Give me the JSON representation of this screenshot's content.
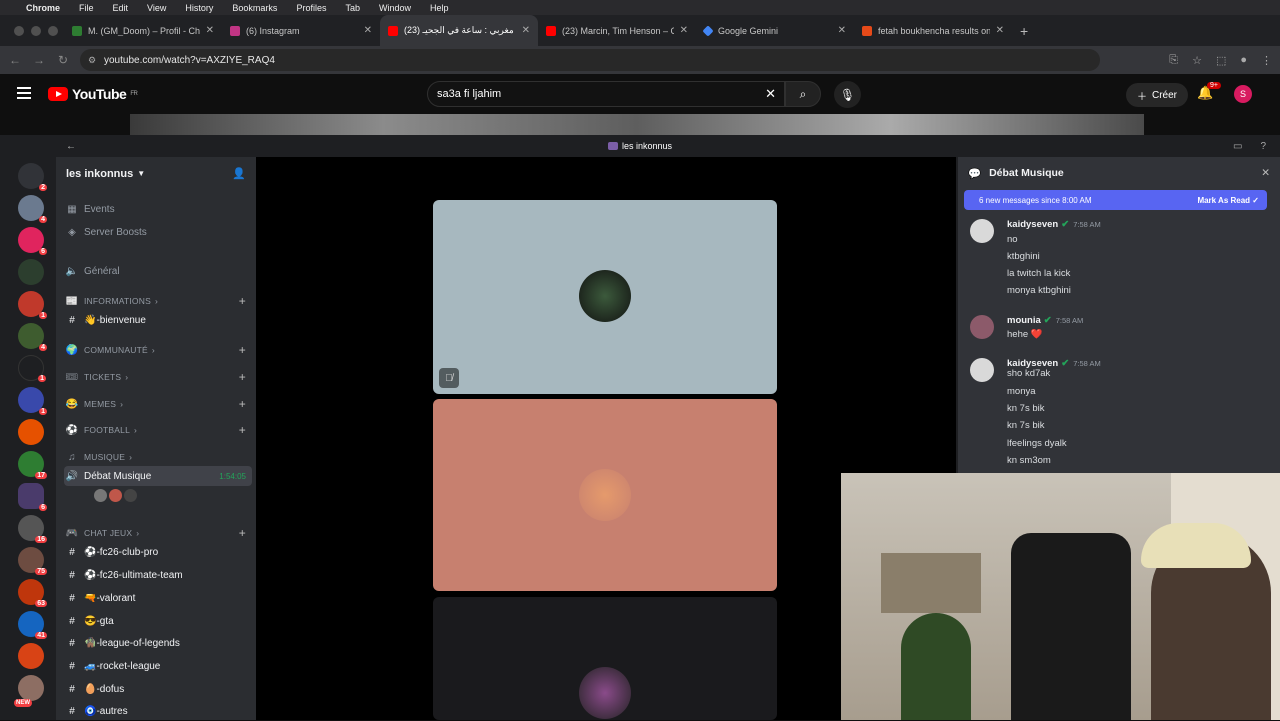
{
  "mac_menu": {
    "apple": "",
    "app": "Chrome",
    "items": [
      "File",
      "Edit",
      "View",
      "History",
      "Bookmarks",
      "Profiles",
      "Tab",
      "Window",
      "Help"
    ]
  },
  "tabs": [
    {
      "title": "M. (GM_Doom) – Profil - Che",
      "color": "#2e7d32"
    },
    {
      "title": "(6) Instagram",
      "color": "#c13584"
    },
    {
      "title": "(23) فيلم مغربي : ساعة في الجحيـ",
      "color": "#ff0000"
    },
    {
      "title": "(23) Marcin, Tim Henson – Cli",
      "color": "#ff0000"
    },
    {
      "title": "Google Gemini",
      "color": "#4285f4"
    },
    {
      "title": "fetah boukhencha results on",
      "color": "#e64a19"
    }
  ],
  "address": {
    "url": "youtube.com/watch?v=AXZIYE_RAQ4"
  },
  "youtube": {
    "logo_text": "YouTube",
    "region": "FR",
    "search_value": "sa3a fi ljahim",
    "create_label": "Créer",
    "notif_count": "9+",
    "avatar_letter": "S"
  },
  "discord": {
    "window_title": "les inkonnus",
    "server_name": "les inkonnus",
    "channels": {
      "events": "Events",
      "boosts": "Server Boosts",
      "general": "Général",
      "cat_informations": "INFORMATIONS",
      "bienvenue": "👋-bienvenue",
      "cat_communaute": "COMMUNAUTÉ",
      "cat_tickets": "TICKETS",
      "cat_memes": "MEMES",
      "cat_football": "FOOTBALL",
      "cat_musique": "MUSIQUE",
      "debat": "Débat Musique",
      "debat_time": "1:54:05",
      "cat_chatjeux": "CHAT JEUX",
      "fc26pro": "⚽-fc26-club-pro",
      "fc26ut": "⚽-fc26-ultimate-team",
      "valorant": "🔫-valorant",
      "gta": "😎-gta",
      "lol": "🧌-league-of-legends",
      "rocket": "🚙-rocket-league",
      "dofus": "🥚-dofus",
      "autres": "🧿-autres"
    },
    "server_badges": [
      "2",
      "4",
      "6",
      "",
      "1",
      "4",
      "1",
      "1",
      "",
      "17",
      "6",
      "16",
      "75",
      "63",
      "41",
      "",
      "NEW"
    ],
    "chat": {
      "title": "Débat Musique",
      "new_messages": "6 new messages since 8:00 AM",
      "mark_read": "Mark As Read",
      "messages": [
        {
          "user": "kaidyseven",
          "time": "7:58 AM",
          "lines": [
            "no",
            "ktbghini",
            "la twitch la kick",
            "monya ktbghini"
          ]
        },
        {
          "user": "mounia",
          "time": "7:58 AM",
          "lines": [
            "hehe ❤️"
          ]
        },
        {
          "user": "kaidyseven",
          "time": "7:58 AM",
          "lines": [
            "sho kd7ak",
            "monya",
            "kn 7s bik",
            "kn 7s bik",
            "lfeelings dyalk",
            "kn sm3om"
          ]
        }
      ]
    }
  }
}
